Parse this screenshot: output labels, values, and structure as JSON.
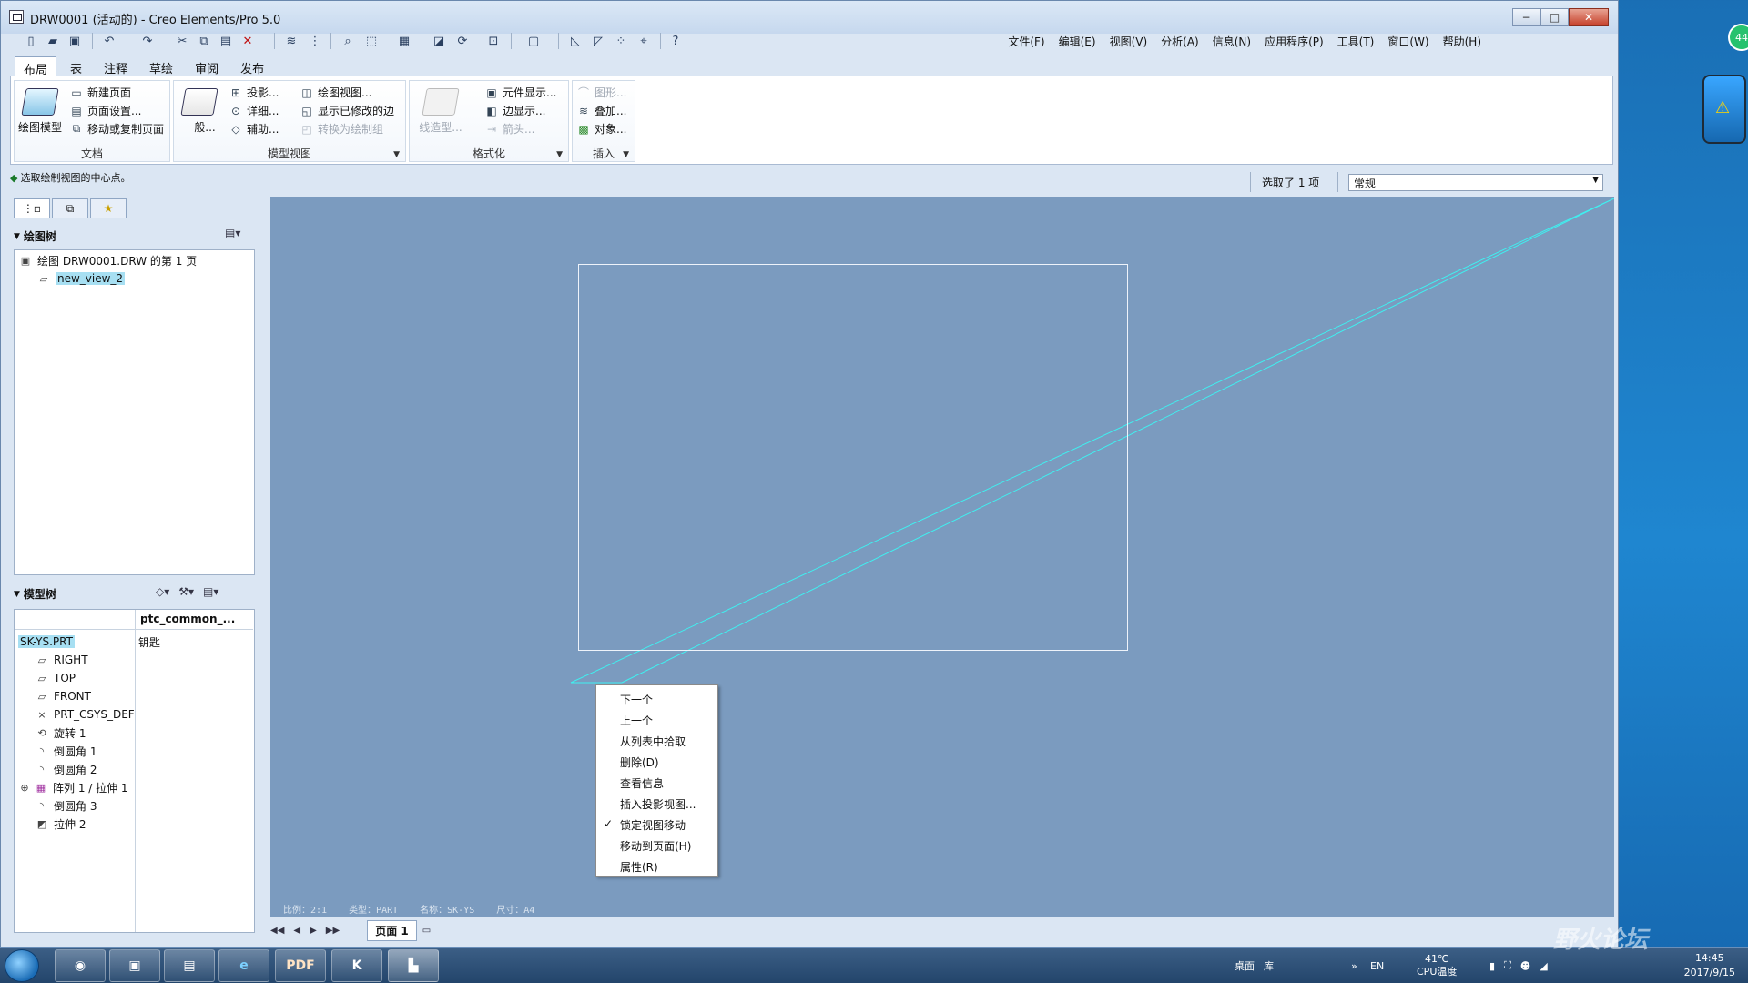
{
  "window": {
    "title": "DRW0001 (活动的) - Creo Elements/Pro 5.0",
    "buttons": [
      "−",
      "□",
      "✕"
    ]
  },
  "menubar": [
    "文件(F)",
    "编辑(E)",
    "视图(V)",
    "分析(A)",
    "信息(N)",
    "应用程序(P)",
    "工具(T)",
    "窗口(W)",
    "帮助(H)"
  ],
  "ribbon": {
    "tabs": [
      "布局",
      "表",
      "注释",
      "草绘",
      "审阅",
      "发布"
    ],
    "active_tab": "布局",
    "groups": {
      "document": {
        "label": "文档",
        "big_button": "绘图模型",
        "items": [
          "新建页面",
          "页面设置...",
          "移动或复制页面"
        ]
      },
      "model_views": {
        "label": "模型视图",
        "big_button": "一般...",
        "col1": [
          "投影...",
          "详细...",
          "辅助..."
        ],
        "col2": [
          "绘图视图...",
          "显示已修改的边",
          "转换为绘制组"
        ]
      },
      "format": {
        "label": "格式化",
        "big_button": "线造型...",
        "items": [
          "元件显示...",
          "边显示...",
          "箭头..."
        ]
      },
      "insert": {
        "label": "插入",
        "items": [
          "图形...",
          "叠加...",
          "对象..."
        ]
      }
    }
  },
  "status": {
    "message": "选取绘制视图的中心点。",
    "selection": "选取了 1 项",
    "filter_value": "常规"
  },
  "drawing_tree": {
    "title": "绘图树",
    "items": [
      "绘图 DRW0001.DRW 的第 1 页",
      "new_view_2"
    ]
  },
  "model_tree": {
    "title": "模型树",
    "column_header": "ptc_common_...",
    "root": "SK-YS.PRT",
    "root_value": "钥匙",
    "items": [
      "RIGHT",
      "TOP",
      "FRONT",
      "PRT_CSYS_DEF",
      "旋转 1",
      "倒圆角 1",
      "倒圆角 2",
      "阵列 1 / 拉伸 1",
      "倒圆角 3",
      "拉伸 2"
    ]
  },
  "canvas_status": [
    "比例：2:1",
    "类型：PART",
    "名称：SK-YS",
    "尺寸：A4"
  ],
  "context_menu": {
    "items": [
      "下一个",
      "上一个",
      "从列表中拾取",
      "删除(D)",
      "查看信息",
      "插入投影视图...",
      "锁定视图移动",
      "移动到页面(H)",
      "属性(R)"
    ],
    "checked_index": 6
  },
  "pagebar": {
    "page_label": "页面 1"
  },
  "taskbar": {
    "apps": [
      "PDF",
      "K"
    ],
    "tray_labels": [
      "桌面",
      "库",
      "EN"
    ],
    "cpu_temp": "41℃",
    "cpu_label": "CPU温度",
    "time": "14:45",
    "date": "2017/9/15"
  },
  "watermark": "野火论坛",
  "gadget_badge": "44",
  "colors": {
    "canvas": "#7b9bbf",
    "view_line": "#3ff0f0",
    "taskbar": "#2c4d74"
  }
}
